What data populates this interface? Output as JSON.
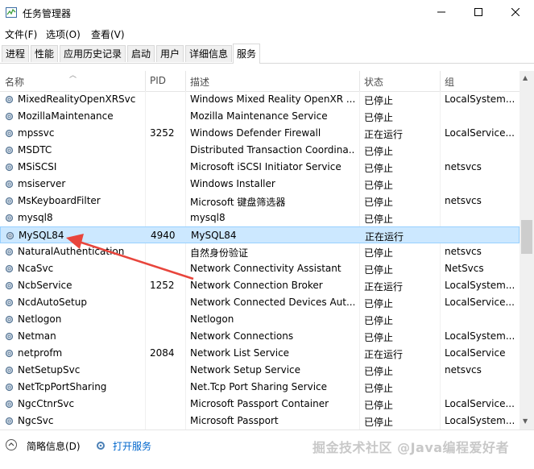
{
  "window": {
    "title": "任务管理器",
    "controls": {
      "minimize": "—",
      "maximize": "☐",
      "close": "✕"
    }
  },
  "menu": [
    {
      "label": "文件(F)"
    },
    {
      "label": "选项(O)"
    },
    {
      "label": "查看(V)"
    }
  ],
  "tabs": [
    {
      "label": "进程"
    },
    {
      "label": "性能"
    },
    {
      "label": "应用历史记录"
    },
    {
      "label": "启动"
    },
    {
      "label": "用户"
    },
    {
      "label": "详细信息"
    },
    {
      "label": "服务",
      "active": true
    }
  ],
  "table": {
    "columns": {
      "name": "名称",
      "pid": "PID",
      "desc": "描述",
      "status": "状态",
      "group": "组"
    },
    "rows": [
      {
        "name": "MixedRealityOpenXRSvc",
        "pid": "",
        "desc": "Windows Mixed Reality OpenXR ...",
        "status": "已停止",
        "group": "LocalSystem..."
      },
      {
        "name": "MozillaMaintenance",
        "pid": "",
        "desc": "Mozilla Maintenance Service",
        "status": "已停止",
        "group": ""
      },
      {
        "name": "mpssvc",
        "pid": "3252",
        "desc": "Windows Defender Firewall",
        "status": "正在运行",
        "group": "LocalService..."
      },
      {
        "name": "MSDTC",
        "pid": "",
        "desc": "Distributed Transaction Coordina...",
        "status": "已停止",
        "group": ""
      },
      {
        "name": "MSiSCSI",
        "pid": "",
        "desc": "Microsoft iSCSI Initiator Service",
        "status": "已停止",
        "group": "netsvcs"
      },
      {
        "name": "msiserver",
        "pid": "",
        "desc": "Windows Installer",
        "status": "已停止",
        "group": ""
      },
      {
        "name": "MsKeyboardFilter",
        "pid": "",
        "desc": "Microsoft 键盘筛选器",
        "status": "已停止",
        "group": "netsvcs"
      },
      {
        "name": "mysql8",
        "pid": "",
        "desc": "mysql8",
        "status": "已停止",
        "group": ""
      },
      {
        "name": "MySQL84",
        "pid": "4940",
        "desc": "MySQL84",
        "status": "正在运行",
        "group": "",
        "selected": true
      },
      {
        "name": "NaturalAuthentication",
        "pid": "",
        "desc": "自然身份验证",
        "status": "已停止",
        "group": "netsvcs"
      },
      {
        "name": "NcaSvc",
        "pid": "",
        "desc": "Network Connectivity Assistant",
        "status": "已停止",
        "group": "NetSvcs"
      },
      {
        "name": "NcbService",
        "pid": "1252",
        "desc": "Network Connection Broker",
        "status": "正在运行",
        "group": "LocalSystem..."
      },
      {
        "name": "NcdAutoSetup",
        "pid": "",
        "desc": "Network Connected Devices Aut...",
        "status": "已停止",
        "group": "LocalService..."
      },
      {
        "name": "Netlogon",
        "pid": "",
        "desc": "Netlogon",
        "status": "已停止",
        "group": ""
      },
      {
        "name": "Netman",
        "pid": "",
        "desc": "Network Connections",
        "status": "已停止",
        "group": "LocalSystem..."
      },
      {
        "name": "netprofm",
        "pid": "2084",
        "desc": "Network List Service",
        "status": "正在运行",
        "group": "LocalService"
      },
      {
        "name": "NetSetupSvc",
        "pid": "",
        "desc": "Network Setup Service",
        "status": "已停止",
        "group": "netsvcs"
      },
      {
        "name": "NetTcpPortSharing",
        "pid": "",
        "desc": "Net.Tcp Port Sharing Service",
        "status": "已停止",
        "group": ""
      },
      {
        "name": "NgcCtnrSvc",
        "pid": "",
        "desc": "Microsoft Passport Container",
        "status": "已停止",
        "group": "LocalService..."
      },
      {
        "name": "NgcSvc",
        "pid": "",
        "desc": "Microsoft Passport",
        "status": "已停止",
        "group": "LocalSystem..."
      }
    ]
  },
  "footer": {
    "brief_label": "简略信息(D)",
    "open_services_label": "打开服务"
  },
  "watermark": "掘金技术社区 @Java编程爱好者",
  "annotation": {
    "arrow_color": "#e8453c",
    "points_to": "MySQL84"
  },
  "colors": {
    "selected_bg": "#cce8ff",
    "link": "#0066cc"
  }
}
